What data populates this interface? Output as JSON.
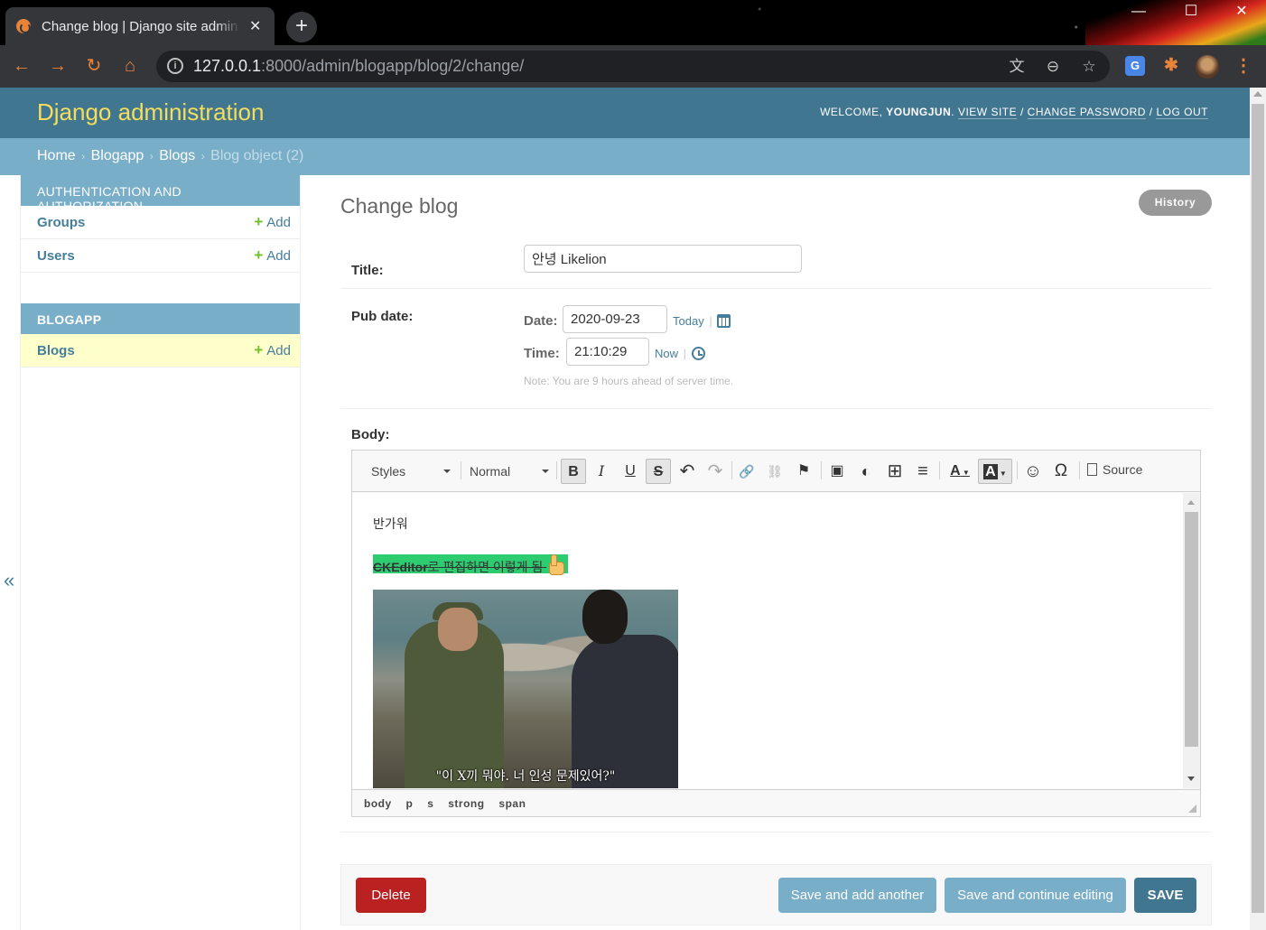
{
  "browser": {
    "tab_title": "Change blog | Django site admin",
    "tab_close": "✕",
    "new_tab": "+",
    "window_controls": {
      "minimize": "—",
      "maximize": "☐",
      "close": "✕"
    },
    "nav": {
      "back": "←",
      "forward": "→",
      "reload": "↻",
      "home": "⌂"
    },
    "url_host": "127.0.0.1",
    "url_path": ":8000/admin/blogapp/blog/2/change/",
    "omnibox_icons": {
      "translate": "文",
      "zoom": "⊖",
      "bookmark": "☆"
    },
    "extensions": {
      "translate": "G",
      "puzzle": "✱",
      "menu": "⋮"
    }
  },
  "header": {
    "branding": "Django administration",
    "welcome": "Welcome,",
    "username": "youngjun",
    "view_site": "View site",
    "change_password": "Change password",
    "logout": "Log out",
    "slash": "/"
  },
  "breadcrumbs": {
    "home": "Home",
    "app": "Blogapp",
    "model": "Blogs",
    "current": "Blog object (2)",
    "separator": "›"
  },
  "sidebar": {
    "modules": [
      {
        "caption": "Authentication and Authorization",
        "rows": [
          {
            "name": "Groups",
            "add": "Add"
          },
          {
            "name": "Users",
            "add": "Add"
          }
        ]
      },
      {
        "caption": "Blogapp",
        "rows": [
          {
            "name": "Blogs",
            "add": "Add"
          }
        ]
      }
    ],
    "toggle": "«"
  },
  "content": {
    "title": "Change blog",
    "history": "History",
    "fields": {
      "title_label": "Title:",
      "title_value": "안녕 Likelion",
      "pubdate_label": "Pub date:",
      "date_label": "Date:",
      "date_value": "2020-09-23",
      "today": "Today",
      "time_label": "Time:",
      "time_value": "21:10:29",
      "now": "Now",
      "divider": "|",
      "note": "Note: You are 9 hours ahead of server time.",
      "body_label": "Body:"
    },
    "editor": {
      "styles_combo": "Styles",
      "format_combo": "Normal",
      "buttons": {
        "bold": "B",
        "italic": "I",
        "underline": "U",
        "strike": "S",
        "undo": "↶",
        "redo": "↷",
        "link": "🔗",
        "unlink": "⛓",
        "anchor": "⚑",
        "image": "▣",
        "flash": "◐",
        "table": "⊞",
        "hline": "≡",
        "textcolor": "A",
        "bgcolor": "A",
        "smiley": "☺",
        "specialchar": "Ω"
      },
      "source": "Source",
      "paragraph": "반가워",
      "highlight_bold": "CKEditor",
      "highlight_text": "로 편집하면 이렇게 됨",
      "image_subtitle": "\"이 X끼 뭐야. 너 인성 문제있어?\"",
      "path": [
        "body",
        "p",
        "s",
        "strong",
        "span"
      ],
      "highlight_color": "#2ecc71"
    },
    "submit": {
      "delete": "Delete",
      "save_add_another": "Save and add another",
      "save_continue": "Save and continue editing",
      "save": "SAVE"
    }
  },
  "colors": {
    "header_bg": "#417690",
    "branding": "#f5dd5d",
    "breadcrumbs_bg": "#79aec8",
    "link": "#447e9b",
    "add_plus": "#70bf2b",
    "delete": "#ba2121",
    "current_row": "#ffffcc"
  }
}
